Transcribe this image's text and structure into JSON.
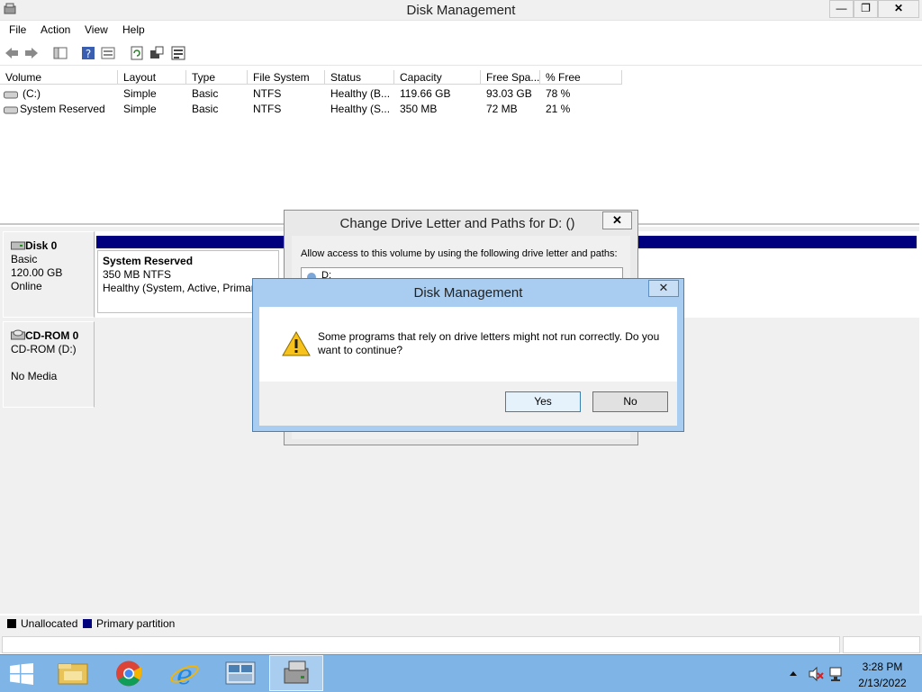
{
  "window": {
    "title": "Disk Management",
    "min": "—",
    "max": "❐",
    "close": "✕"
  },
  "menu": [
    "File",
    "Action",
    "View",
    "Help"
  ],
  "volumes": {
    "columns": [
      "Volume",
      "Layout",
      "Type",
      "File System",
      "Status",
      "Capacity",
      "Free Spa...",
      "% Free"
    ],
    "rows": [
      [
        "(C:)",
        "Simple",
        "Basic",
        "NTFS",
        "Healthy (B...",
        "119.66 GB",
        "93.03 GB",
        "78 %"
      ],
      [
        "System Reserved",
        "Simple",
        "Basic",
        "NTFS",
        "Healthy (S...",
        "350 MB",
        "72 MB",
        "21 %"
      ]
    ]
  },
  "disks": {
    "disk0": {
      "name": "Disk 0",
      "type": "Basic",
      "size": "120.00 GB",
      "state": "Online",
      "partition": {
        "name": "System Reserved",
        "fs": "350 MB NTFS",
        "status": "Healthy (System, Active, Primar"
      }
    },
    "cdrom": {
      "name": "CD-ROM 0",
      "drive": "CD-ROM (D:)",
      "media": "No Media"
    }
  },
  "legend": {
    "unallocated": "Unallocated",
    "primary": "Primary partition",
    "colors": {
      "unallocated": "#000000",
      "primary": "#00007f"
    }
  },
  "cdl_dialog": {
    "title": "Change Drive Letter and Paths for D: ()",
    "close": "✕",
    "description": "Allow access to this volume by using the following drive letter and paths:",
    "entry": "D:"
  },
  "confirm_dialog": {
    "title": "Disk Management",
    "close": "✕",
    "message": "Some programs that rely on drive letters might not run correctly. Do you want to continue?",
    "yes": "Yes",
    "no": "No"
  },
  "taskbar": {
    "time": "3:28 PM",
    "date": "2/13/2022",
    "apps": [
      "start-button",
      "file-explorer-icon",
      "chrome-icon",
      "internet-explorer-icon",
      "server-manager-icon",
      "disk-management-icon"
    ]
  }
}
